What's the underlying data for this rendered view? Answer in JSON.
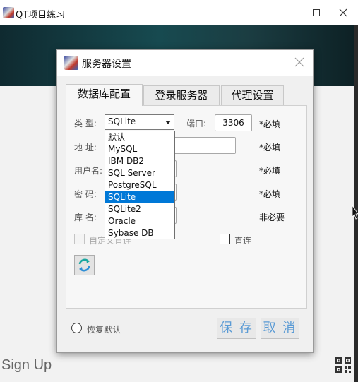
{
  "main_window": {
    "title": "QT项目练习",
    "signup_text": "Sign Up"
  },
  "dialog": {
    "title": "服务器设置",
    "tabs": [
      {
        "label": "数据库配置",
        "active": true
      },
      {
        "label": "登录服务器",
        "active": false
      },
      {
        "label": "代理设置",
        "active": false
      }
    ],
    "form": {
      "type_label": "类 型:",
      "type_value": "SQLite",
      "port_label": "端口:",
      "port_value": "3306",
      "address_label": "地 址:",
      "username_label": "用户名:",
      "password_label": "密 码:",
      "dbname_label": "库 名:",
      "required_text": "*必填",
      "optional_text": "非必要"
    },
    "type_options": [
      "默认",
      "MySQL",
      "IBM DB2",
      "SQL Server",
      "PostgreSQL",
      "SQLite",
      "SQLite2",
      "Oracle",
      "Sybase DB"
    ],
    "selected_option": "SQLite",
    "auto_checkbox_label": "自定义直连",
    "direct_checkbox_label": "直连",
    "restore_default_label": "恢复默认",
    "save_label": "保 存",
    "cancel_label": "取 消"
  },
  "colors": {
    "accent": "#0078d7",
    "button_text": "#5b9bd5",
    "banner": "#174a50"
  },
  "icons": {
    "app": "app-logo-icon",
    "close": "close-icon",
    "refresh": "refresh-icon",
    "qr": "qr-code-icon"
  }
}
